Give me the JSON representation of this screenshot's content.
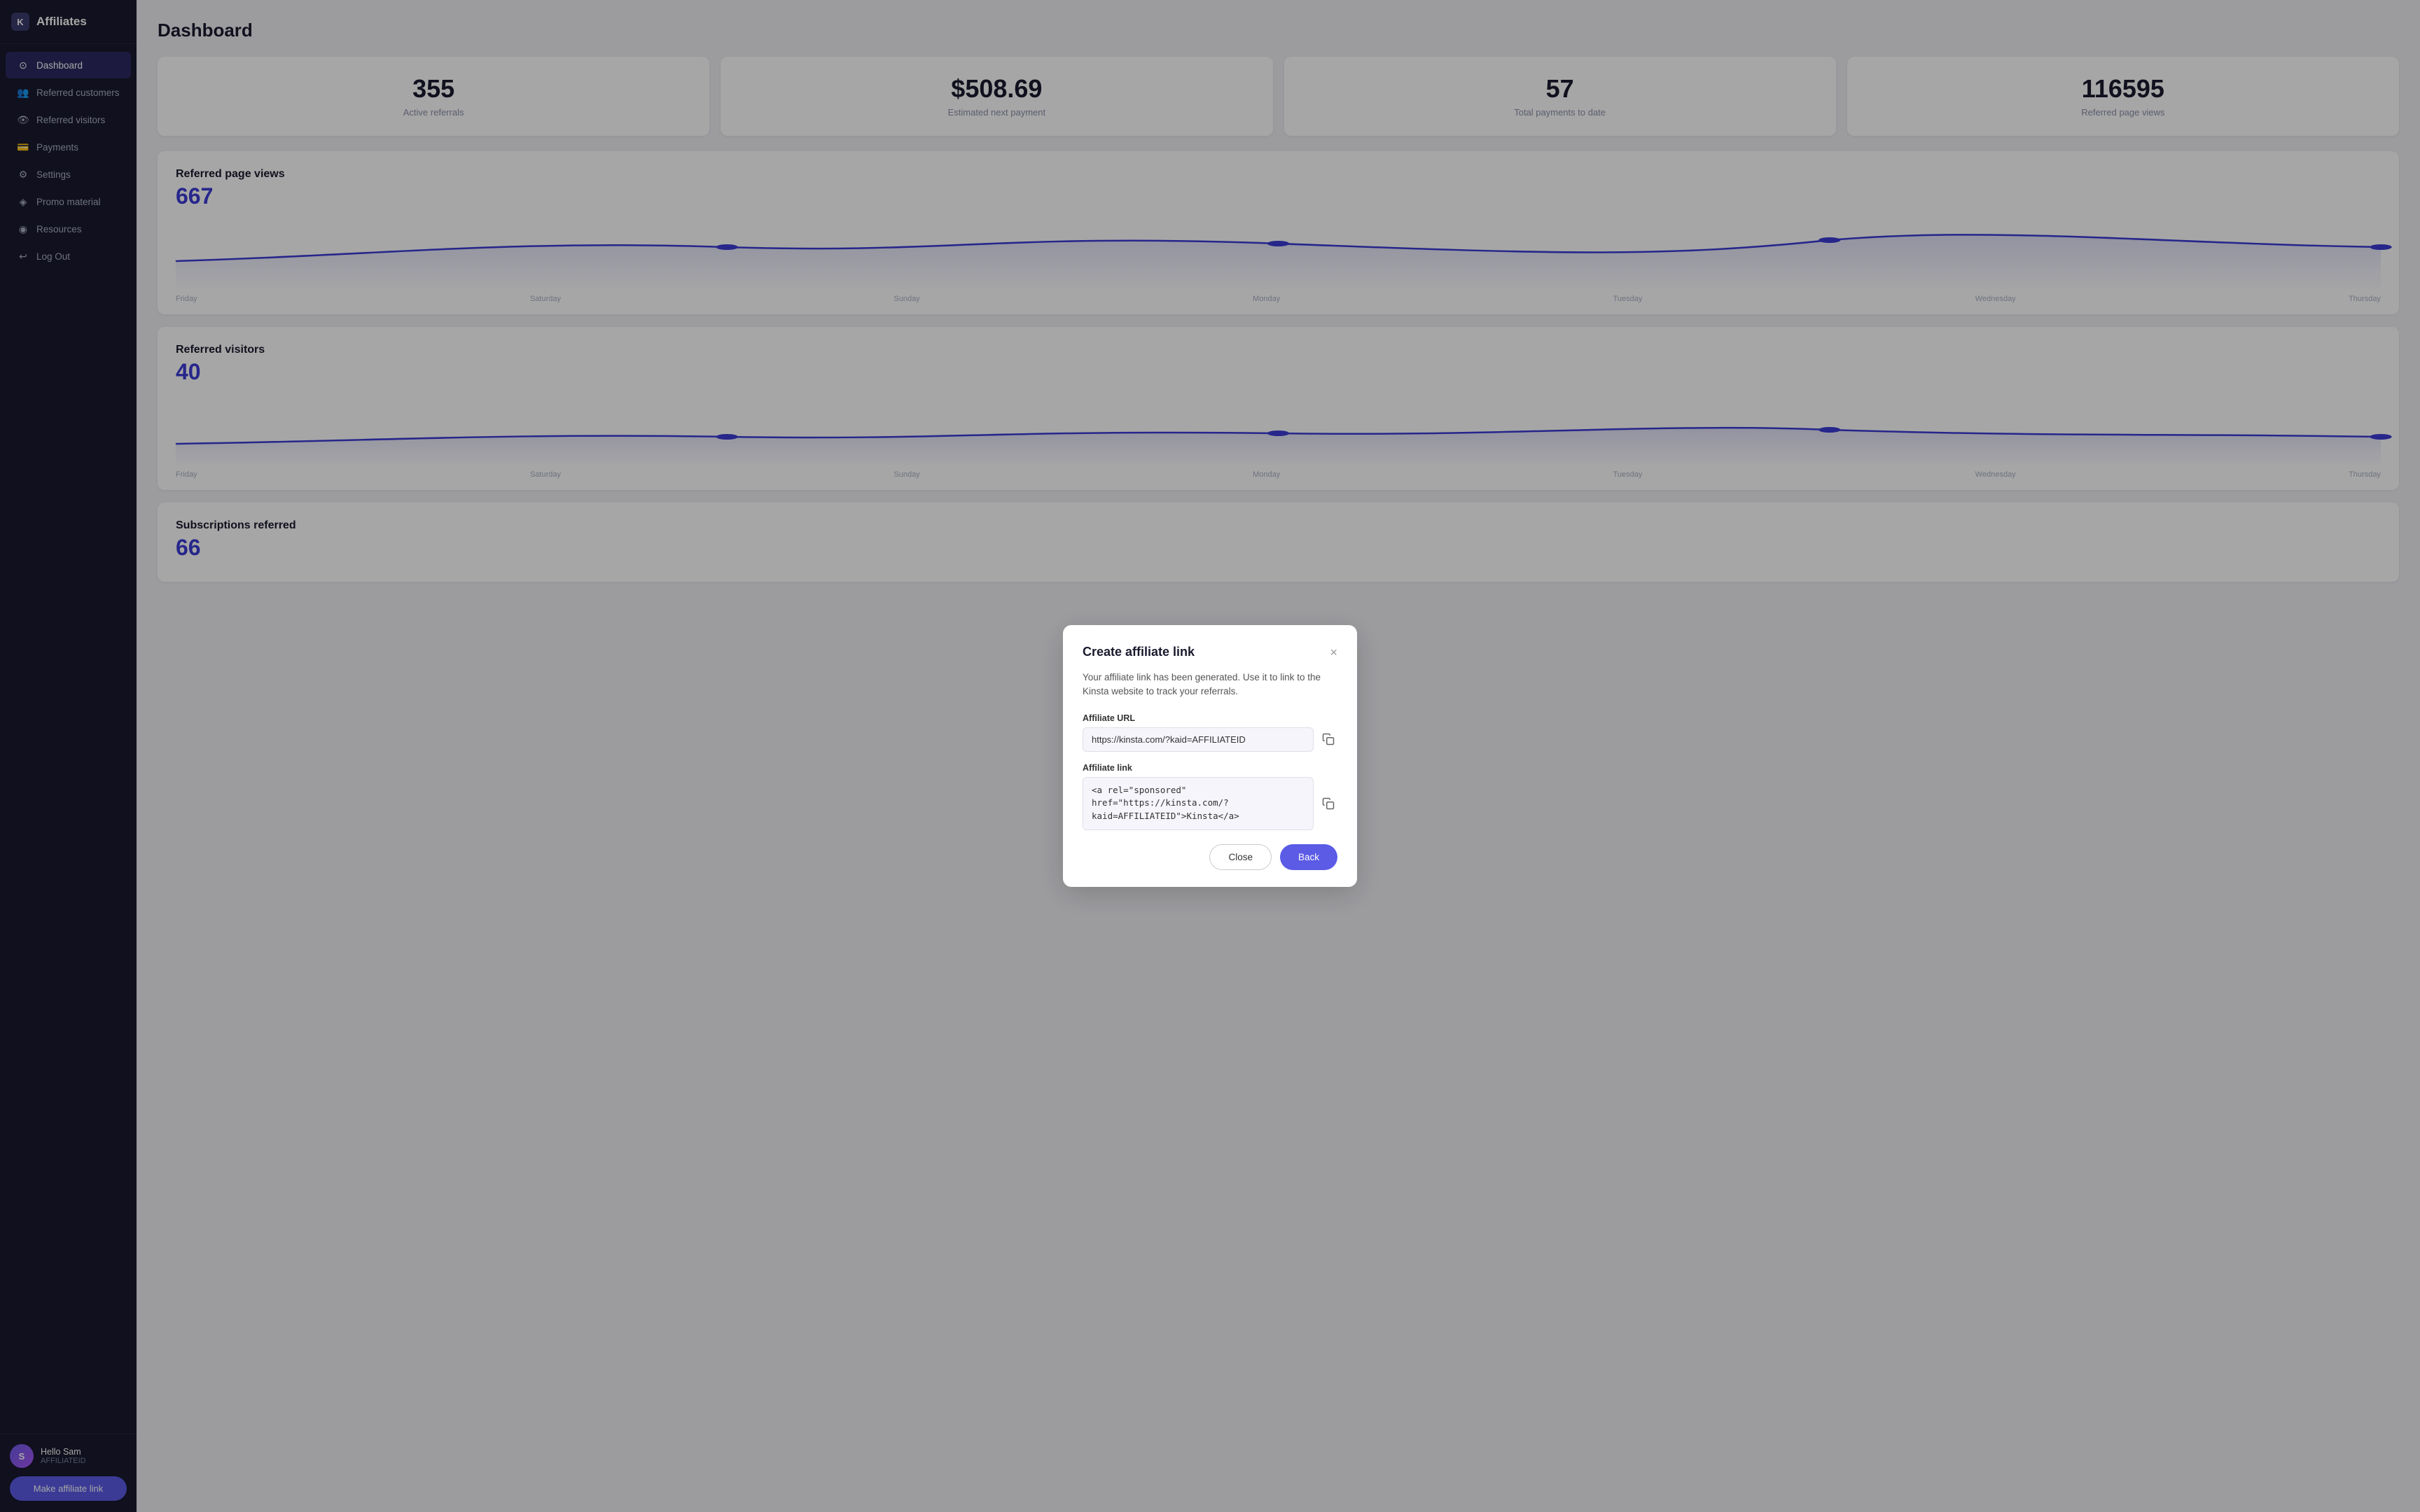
{
  "app": {
    "name": "Affiliates",
    "logo_text": "K"
  },
  "sidebar": {
    "items": [
      {
        "id": "dashboard",
        "label": "Dashboard",
        "icon": "⊙",
        "active": true
      },
      {
        "id": "referred-customers",
        "label": "Referred customers",
        "icon": "👥",
        "active": false
      },
      {
        "id": "referred-visitors",
        "label": "Referred visitors",
        "icon": "👁",
        "active": false
      },
      {
        "id": "payments",
        "label": "Payments",
        "icon": "💳",
        "active": false
      },
      {
        "id": "settings",
        "label": "Settings",
        "icon": "⚙",
        "active": false
      },
      {
        "id": "promo-material",
        "label": "Promo material",
        "icon": "◈",
        "active": false
      },
      {
        "id": "resources",
        "label": "Resources",
        "icon": "◉",
        "active": false
      },
      {
        "id": "logout",
        "label": "Log Out",
        "icon": "↩",
        "active": false
      }
    ],
    "make_link_label": "Make affiliate link"
  },
  "user": {
    "name": "Hello Sam",
    "id": "AFFILIATEID",
    "avatar_initials": "S"
  },
  "page": {
    "title": "Dashboard"
  },
  "stats": [
    {
      "value": "355",
      "label": "Active referrals"
    },
    {
      "value": "$508.69",
      "label": "Estimated next payment"
    },
    {
      "value": "57",
      "label": "Total payments to date"
    },
    {
      "value": "116595",
      "label": "Referred page views"
    }
  ],
  "charts": [
    {
      "id": "referred-page-views",
      "title": "Referred page views",
      "number": "667",
      "labels": [
        "Friday",
        "Saturday",
        "Sunday",
        "Monday",
        "Tuesday",
        "Wednesday",
        "Thursday"
      ]
    },
    {
      "id": "referred-visitors",
      "title": "Referred visitors",
      "number": "40",
      "labels": [
        "Friday",
        "Saturday",
        "Sunday",
        "Monday",
        "Tuesday",
        "Wednesday",
        "Thursday"
      ]
    },
    {
      "id": "subscriptions-referred",
      "title": "Subscriptions referred",
      "number": "66",
      "labels": []
    }
  ],
  "modal": {
    "title": "Create affiliate link",
    "description": "Your affiliate link has been generated. Use it to link to the Kinsta website to track your referrals.",
    "affiliate_url_label": "Affiliate URL",
    "affiliate_url_value": "https://kinsta.com/?kaid=AFFILIATEID",
    "affiliate_link_label": "Affiliate link",
    "affiliate_link_value": "<a rel=\"sponsored\"\nhref=\"https://kinsta.com/?\nkaid=AFFILIATEID\">Kinsta</a>",
    "close_label": "Close",
    "back_label": "Back"
  }
}
